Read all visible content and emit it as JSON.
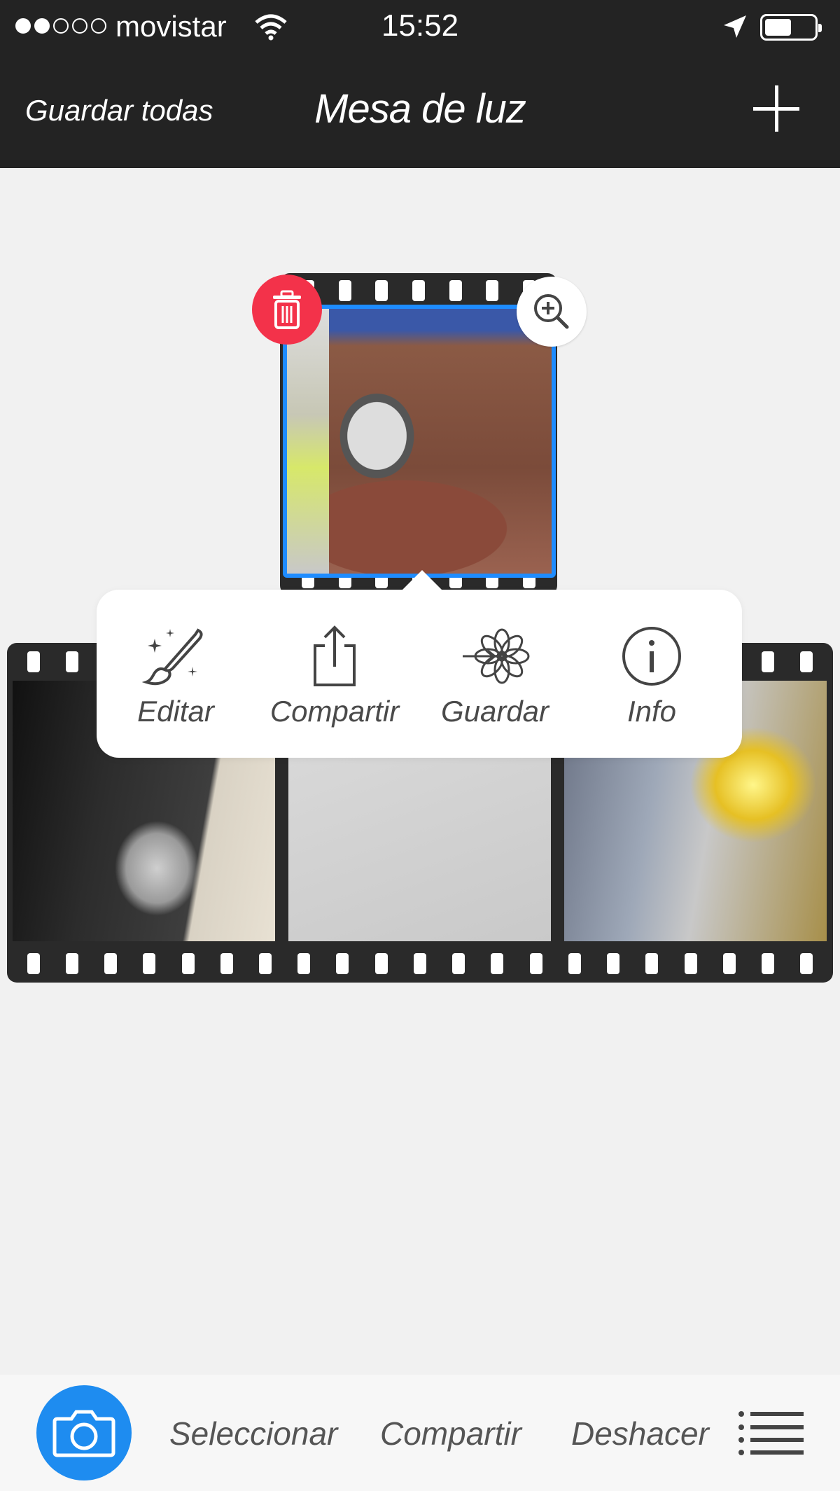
{
  "status_bar": {
    "signal_filled": 2,
    "signal_total": 5,
    "carrier": "movistar",
    "time": "15:52",
    "battery_level": 0.55
  },
  "nav": {
    "left_label": "Guardar todas",
    "title": "Mesa de luz",
    "right_icon": "plus-icon"
  },
  "lightbox": {
    "selected_photo": "photo-1",
    "photos": [
      "photo-1",
      "photo-2",
      "photo-3",
      "photo-4"
    ]
  },
  "popover": {
    "actions": [
      {
        "label": "Editar",
        "icon": "magic-brush-icon"
      },
      {
        "label": "Compartir",
        "icon": "share-icon"
      },
      {
        "label": "Guardar",
        "icon": "save-flower-icon"
      },
      {
        "label": "Info",
        "icon": "info-icon"
      }
    ]
  },
  "toolbar": {
    "camera_icon": "camera-icon",
    "select_label": "Seleccionar",
    "share_label": "Compartir",
    "undo_label": "Deshacer",
    "menu_icon": "list-menu-icon"
  },
  "colors": {
    "header_bg": "#232323",
    "accent_blue": "#1e8cff",
    "delete_red": "#f3324a",
    "canvas_bg": "#f1f1f1"
  }
}
